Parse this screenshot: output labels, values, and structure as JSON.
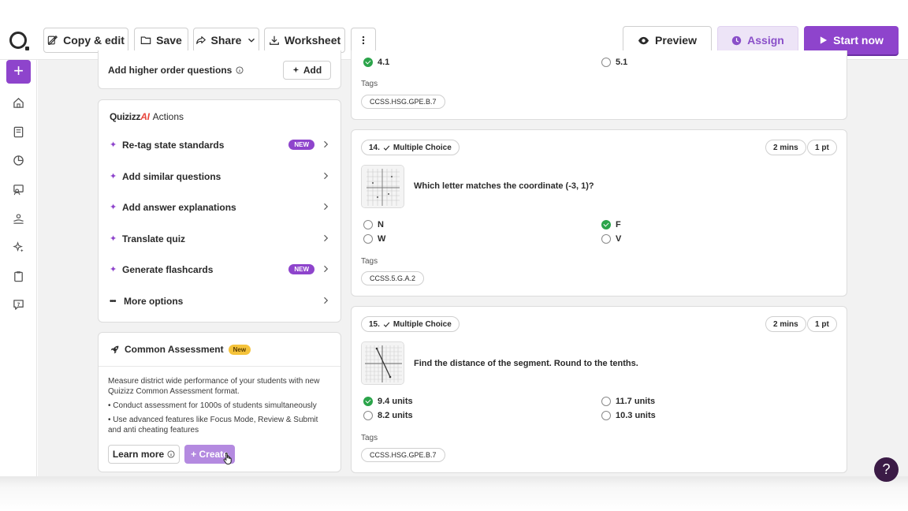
{
  "toolbar": {
    "copy_edit": "Copy & edit",
    "save": "Save",
    "share": "Share",
    "worksheet": "Worksheet",
    "preview": "Preview",
    "assign": "Assign",
    "start_now": "Start now"
  },
  "rail": {
    "items": [
      "plus-icon",
      "home-icon",
      "library-icon",
      "reports-icon",
      "classes-icon",
      "accommodations-icon",
      "ai-icon",
      "clipboard-icon",
      "help-chat-icon"
    ]
  },
  "left_panel": {
    "higher_order": {
      "label": "Add higher order questions",
      "add_label": "Add"
    },
    "ai_actions": {
      "brand": "Quizizz",
      "brand_ai": "AI",
      "title": "Actions",
      "items": [
        {
          "label": "Re-tag state standards",
          "badge": "NEW"
        },
        {
          "label": "Add similar questions",
          "badge": ""
        },
        {
          "label": "Add answer explanations",
          "badge": ""
        },
        {
          "label": "Translate quiz",
          "badge": ""
        },
        {
          "label": "Generate flashcards",
          "badge": "NEW"
        },
        {
          "label": "More options",
          "badge": ""
        }
      ]
    },
    "common_assessment": {
      "title": "Common Assessment",
      "badge": "New",
      "description": "Measure district wide performance of your students with new Quizizz Common Assessment format.",
      "bullet1": "• Conduct assessment for 1000s of students simultaneously",
      "bullet2": "• Use advanced features like Focus Mode, Review & Submit and anti cheating features",
      "learn_more": "Learn more",
      "create": "+ Create"
    }
  },
  "questions": {
    "prev": {
      "options": [
        "4.1",
        "5.1"
      ],
      "tags_label": "Tags",
      "tag": "CCSS.HSG.GPE.B.7"
    },
    "q14": {
      "number": "14.",
      "type": "Multiple Choice",
      "time": "2 mins",
      "points": "1 pt",
      "text": "Which letter matches the coordinate (-3, 1)?",
      "options": [
        "N",
        "F",
        "W",
        "V"
      ],
      "correct": "F",
      "tags_label": "Tags",
      "tag": "CCSS.5.G.A.2"
    },
    "q15": {
      "number": "15.",
      "type": "Multiple Choice",
      "time": "2 mins",
      "points": "1 pt",
      "text": "Find the distance of the segment.  Round to the tenths.",
      "options": [
        "9.4 units",
        "11.7 units",
        "8.2 units",
        "10.3 units"
      ],
      "correct": "9.4 units",
      "tags_label": "Tags",
      "tag": "CCSS.HSG.GPE.B.7"
    }
  },
  "help": "?"
}
